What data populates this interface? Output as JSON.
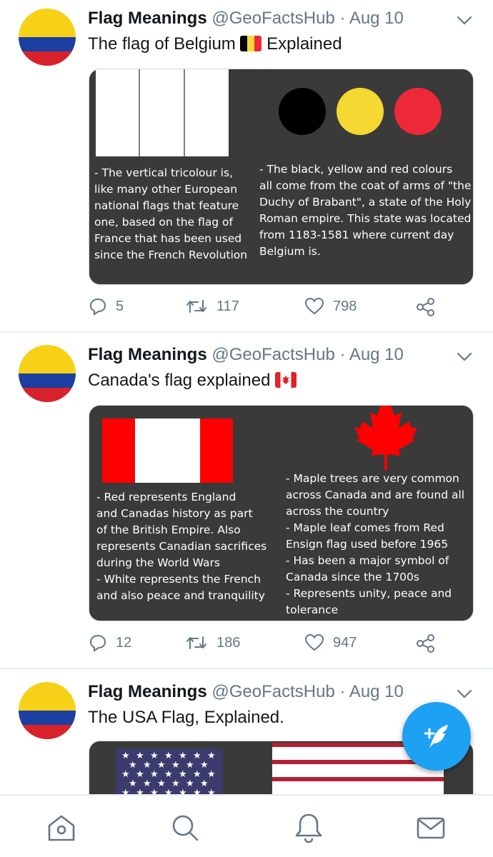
{
  "author": {
    "name": "Flag Meanings",
    "handle": "@GeoFactsHub",
    "separator": "·",
    "date": "Aug 10"
  },
  "colors": {
    "accent": "#1da1f2",
    "card_bg": "#3a3a3a",
    "muted": "#657786",
    "avatar_stripes": [
      "#f7d117",
      "#1a3fa0",
      "#d8222b"
    ]
  },
  "tweets": [
    {
      "text_before": "The flag of Belgium",
      "text_after": "Explained",
      "emoji": "belgium-flag",
      "card": {
        "left_caption": "- The vertical tricolour is,\nlike many other European\nnational flags that feature\none, based on the flag of\nFrance that has been used\nsince the French Revolution",
        "right_caption": "- The black, yellow and red colours\nall come from the coat of arms of \"the\nDuchy of Brabant\", a state of the Holy\nRoman empire. This state was located\nfrom 1183-1581 where current day\nBelgium is.",
        "circle_colors": [
          "#000000",
          "#f5d832",
          "#ed2939"
        ]
      },
      "replies": "5",
      "retweets": "117",
      "likes": "798"
    },
    {
      "text_before": "Canada's flag explained",
      "text_after": "",
      "emoji": "canada-flag",
      "card": {
        "left_caption": "- Red represents England\nand Canadas history as part\nof the British Empire. Also\nrepresents Canadian sacrifices\nduring the World Wars\n- White represents the French\nand also peace and tranquility",
        "right_caption": "- Maple trees are very common\nacross Canada and are found all\nacross the country\n- Maple leaf comes from Red\nEnsign flag used before 1965\n- Has been a major symbol of\nCanada since the 1700s\n- Represents unity, peace and\ntolerance",
        "flag_red": "#ff0000"
      },
      "replies": "12",
      "retweets": "186",
      "likes": "947"
    },
    {
      "text_before": "The USA Flag, Explained.",
      "text_after": "",
      "emoji": "",
      "card": {
        "canton_color": "#3c3b6e",
        "stripe_red": "#b22234"
      }
    }
  ],
  "icons": {
    "reply": "reply-icon",
    "retweet": "retweet-icon",
    "like": "heart-icon",
    "share": "share-icon",
    "nav": [
      "home-icon",
      "search-icon",
      "notifications-icon",
      "messages-icon"
    ],
    "fab": "compose-tweet-icon"
  }
}
